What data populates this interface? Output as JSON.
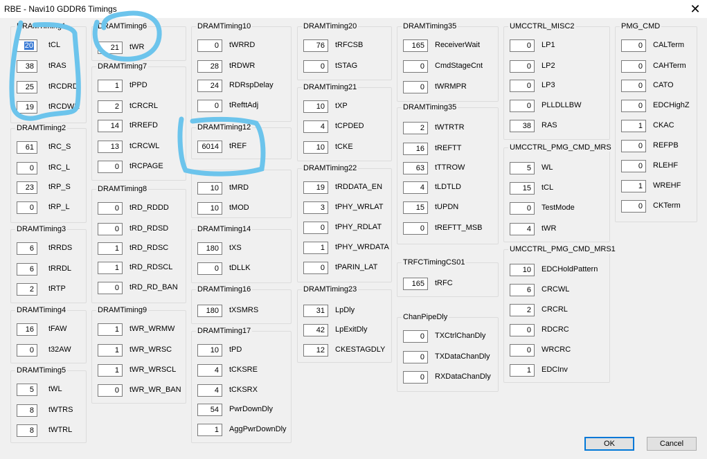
{
  "window": {
    "title": "RBE - Navi10 GDDR6 Timings",
    "close_glyph": "✕"
  },
  "groups": [
    {
      "name": "DRAMTiming1",
      "rows": [
        [
          "20",
          "tCL"
        ],
        [
          "38",
          "tRAS"
        ],
        [
          "25",
          "tRCDRD"
        ],
        [
          "19",
          "tRCDWR"
        ]
      ]
    },
    {
      "name": "DRAMTiming2",
      "rows": [
        [
          "61",
          "tRC_S"
        ],
        [
          "0",
          "tRC_L"
        ],
        [
          "23",
          "tRP_S"
        ],
        [
          "0",
          "tRP_L"
        ]
      ]
    },
    {
      "name": "DRAMTiming3",
      "rows": [
        [
          "6",
          "tRRDS"
        ],
        [
          "6",
          "tRRDL"
        ],
        [
          "2",
          "tRTP"
        ]
      ]
    },
    {
      "name": "DRAMTiming4",
      "rows": [
        [
          "16",
          "tFAW"
        ],
        [
          "0",
          "t32AW"
        ]
      ]
    },
    {
      "name": "DRAMTiming5",
      "rows": [
        [
          "5",
          "tWL"
        ],
        [
          "8",
          "tWTRS"
        ],
        [
          "8",
          "tWTRL"
        ]
      ]
    },
    {
      "name": "DRAMTiming6",
      "rows": [
        [
          "21",
          "tWR"
        ]
      ]
    },
    {
      "name": "DRAMTiming7",
      "rows": [
        [
          "1",
          "tPPD"
        ],
        [
          "2",
          "tCRCRL"
        ],
        [
          "14",
          "tRREFD"
        ],
        [
          "13",
          "tCRCWL"
        ],
        [
          "0",
          "tRCPAGE"
        ]
      ]
    },
    {
      "name": "DRAMTiming8",
      "rows": [
        [
          "0",
          "tRD_RDDD"
        ],
        [
          "0",
          "tRD_RDSD"
        ],
        [
          "1",
          "tRD_RDSC"
        ],
        [
          "1",
          "tRD_RDSCL"
        ],
        [
          "0",
          "tRD_RD_BAN"
        ]
      ]
    },
    {
      "name": "DRAMTiming9",
      "rows": [
        [
          "1",
          "tWR_WRMW"
        ],
        [
          "1",
          "tWR_WRSC"
        ],
        [
          "1",
          "tWR_WRSCL"
        ],
        [
          "0",
          "tWR_WR_BAN"
        ]
      ]
    },
    {
      "name": "DRAMTiming10",
      "rows": [
        [
          "0",
          "tWRRD"
        ],
        [
          "28",
          "tRDWR"
        ],
        [
          "24",
          "RDRspDelay"
        ],
        [
          "0",
          "tRefttAdj"
        ]
      ]
    },
    {
      "name": "DRAMTiming12",
      "rows": [
        [
          "6014",
          "tREF"
        ]
      ]
    },
    {
      "name": "",
      "rows": [
        [
          "10",
          "tMRD"
        ],
        [
          "10",
          "tMOD"
        ]
      ]
    },
    {
      "name": "DRAMTiming14",
      "rows": [
        [
          "180",
          "tXS"
        ],
        [
          "0",
          "tDLLK"
        ]
      ]
    },
    {
      "name": "DRAMTiming16",
      "rows": [
        [
          "180",
          "tXSMRS"
        ]
      ]
    },
    {
      "name": "DRAMTiming17",
      "rows": [
        [
          "10",
          "tPD"
        ],
        [
          "4",
          "tCKSRE"
        ],
        [
          "4",
          "tCKSRX"
        ],
        [
          "54",
          "PwrDownDly"
        ],
        [
          "1",
          "AggPwrDownDly"
        ]
      ]
    },
    {
      "name": "DRAMTiming20",
      "rows": [
        [
          "76",
          "tRFCSB"
        ],
        [
          "0",
          "tSTAG"
        ]
      ]
    },
    {
      "name": "DRAMTiming21",
      "rows": [
        [
          "10",
          "tXP"
        ],
        [
          "4",
          "tCPDED"
        ],
        [
          "10",
          "tCKE"
        ]
      ]
    },
    {
      "name": "DRAMTiming22",
      "rows": [
        [
          "19",
          "tRDDATA_EN"
        ],
        [
          "3",
          "tPHY_WRLAT"
        ],
        [
          "0",
          "tPHY_RDLAT"
        ],
        [
          "1",
          "tPHY_WRDATA"
        ],
        [
          "0",
          "tPARIN_LAT"
        ]
      ]
    },
    {
      "name": "DRAMTiming23",
      "rows": [
        [
          "31",
          "LpDly"
        ],
        [
          "42",
          "LpExitDly"
        ],
        [
          "12",
          "CKESTAGDLY"
        ]
      ]
    },
    {
      "name": "DRAMTiming35",
      "rows": [
        [
          "165",
          "ReceiverWait"
        ],
        [
          "0",
          "CmdStageCnt"
        ],
        [
          "0",
          "tWRMPR"
        ]
      ]
    },
    {
      "name": "DRAMTiming35",
      "rows": [
        [
          "2",
          "tWTRTR"
        ],
        [
          "16",
          "tREFTT"
        ],
        [
          "63",
          "tTTROW"
        ],
        [
          "4",
          "tLDTLD"
        ],
        [
          "15",
          "tUPDN"
        ],
        [
          "0",
          "tREFTT_MSB"
        ]
      ]
    },
    {
      "name": "TRFCTimingCS01",
      "rows": [
        [
          "165",
          "tRFC"
        ]
      ]
    },
    {
      "name": "ChanPipeDly",
      "rows": [
        [
          "0",
          "TXCtrlChanDly"
        ],
        [
          "0",
          "TXDataChanDly"
        ],
        [
          "0",
          "RXDataChanDly"
        ]
      ]
    },
    {
      "name": "UMCCTRL_MISC2",
      "rows": [
        [
          "0",
          "LP1"
        ],
        [
          "0",
          "LP2"
        ],
        [
          "0",
          "LP3"
        ],
        [
          "0",
          "PLLDLLBW"
        ],
        [
          "38",
          "RAS"
        ]
      ]
    },
    {
      "name": "UMCCTRL_PMG_CMD_MRS",
      "rows": [
        [
          "5",
          "WL"
        ],
        [
          "15",
          "tCL"
        ],
        [
          "0",
          "TestMode"
        ],
        [
          "4",
          "tWR"
        ]
      ]
    },
    {
      "name": "UMCCTRL_PMG_CMD_MRS1",
      "rows": [
        [
          "10",
          "EDCHoldPattern"
        ],
        [
          "6",
          "CRCWL"
        ],
        [
          "2",
          "CRCRL"
        ],
        [
          "0",
          "RDCRC"
        ],
        [
          "0",
          "WRCRC"
        ],
        [
          "1",
          "EDCInv"
        ]
      ]
    },
    {
      "name": "PMG_CMD",
      "rows": [
        [
          "0",
          "CALTerm"
        ],
        [
          "0",
          "CAHTerm"
        ],
        [
          "0",
          "CATO"
        ],
        [
          "0",
          "EDCHighZ"
        ],
        [
          "1",
          "CKAC"
        ],
        [
          "0",
          "REFPB"
        ],
        [
          "0",
          "RLEHF"
        ],
        [
          "1",
          "WREHF"
        ],
        [
          "0",
          "CKTerm"
        ]
      ]
    }
  ],
  "buttons": {
    "ok": "OK",
    "cancel": "Cancel"
  },
  "annotation_color": "#6cc4ec"
}
